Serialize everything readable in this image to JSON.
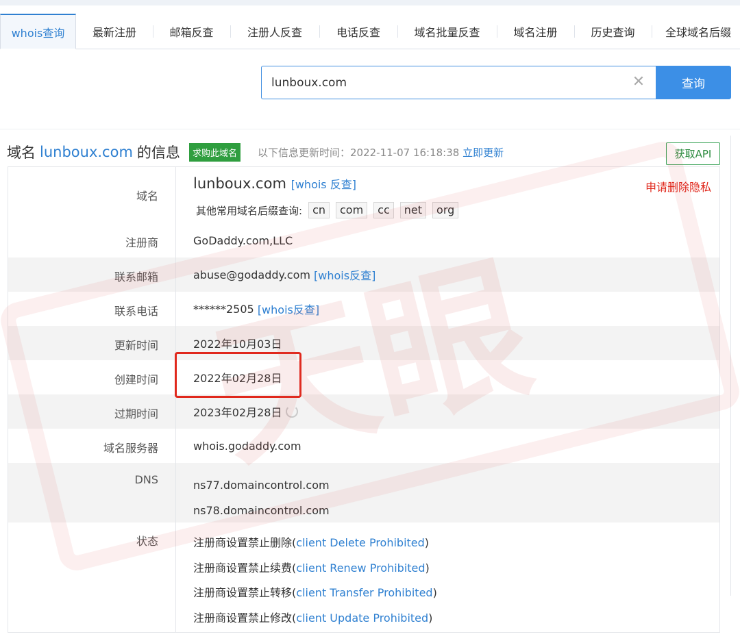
{
  "tabs": [
    {
      "label": "whois查询",
      "active": true
    },
    {
      "label": "最新注册"
    },
    {
      "label": "邮箱反查"
    },
    {
      "label": "注册人反查"
    },
    {
      "label": "电话反查"
    },
    {
      "label": "域名批量反查"
    },
    {
      "label": "域名注册"
    },
    {
      "label": "历史查询"
    },
    {
      "label": "全球域名后缀"
    }
  ],
  "search": {
    "value": "lunboux.com",
    "clear_icon": "close-icon",
    "button_label": "查询"
  },
  "info": {
    "title_prefix": "域名",
    "domain": "lunboux.com",
    "title_suffix": "的信息",
    "buy_label": "求购此域名",
    "update_text": "以下信息更新时间：2022-11-07 16:18:38",
    "update_link": "立即更新",
    "api_label": "获取API"
  },
  "rows": {
    "domain": {
      "label": "域名",
      "value": "lunboux.com",
      "link": "[whois 反查]",
      "privacy": "申请删除隐私",
      "suffix_prompt": "其他常用域名后缀查询:",
      "suffixes": [
        "cn",
        "com",
        "cc",
        "net",
        "org"
      ]
    },
    "registrar": {
      "label": "注册商",
      "value": "GoDaddy.com,LLC"
    },
    "email": {
      "label": "联系邮箱",
      "value": "abuse@godaddy.com",
      "link": "[whois反查]"
    },
    "phone": {
      "label": "联系电话",
      "value": "******2505",
      "link": "[whois反查]"
    },
    "updated": {
      "label": "更新时间",
      "value": "2022年10月03日"
    },
    "created": {
      "label": "创建时间",
      "value": "2022年02月28日"
    },
    "expires": {
      "label": "过期时间",
      "value": "2023年02月28日"
    },
    "whois_server": {
      "label": "域名服务器",
      "value": "whois.godaddy.com"
    },
    "dns": {
      "label": "DNS",
      "values": [
        "ns77.domaincontrol.com",
        "ns78.domaincontrol.com"
      ]
    },
    "status": {
      "label": "状态",
      "items": [
        {
          "text": "注册商设置禁止删除",
          "code": "client Delete Prohibited"
        },
        {
          "text": "注册商设置禁止续费",
          "code": "client Renew Prohibited"
        },
        {
          "text": "注册商设置禁止转移",
          "code": "client Transfer Prohibited"
        },
        {
          "text": "注册商设置禁止修改",
          "code": "client Update Prohibited"
        }
      ]
    }
  },
  "colors": {
    "accent": "#2f80d1",
    "buy_badge": "#2f9e3f",
    "highlight": "#e0281c",
    "watermark": "#d9534f"
  },
  "watermark_text": "天眼"
}
